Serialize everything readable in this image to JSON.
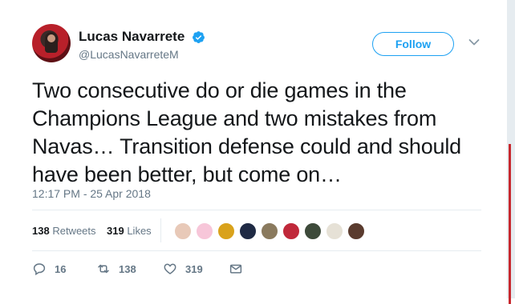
{
  "author": {
    "display_name": "Lucas Navarrete",
    "handle": "@LucasNavarreteM",
    "verified": true
  },
  "buttons": {
    "follow_label": "Follow"
  },
  "tweet": {
    "text": "Two consecutive do or die games in the Champions League and two mistakes from Navas… Transition defense could and should have been better, but come on…",
    "timestamp": "12:17 PM - 25 Apr 2018"
  },
  "stats": {
    "retweets_count": "138",
    "retweets_label": "Retweets",
    "likes_count": "319",
    "likes_label": "Likes"
  },
  "likers": [
    {
      "icon": "liker-avatar-1",
      "color": "#e8c9b8"
    },
    {
      "icon": "liker-avatar-2",
      "color": "#f7c6d9"
    },
    {
      "icon": "liker-avatar-3",
      "color": "#d9a21b"
    },
    {
      "icon": "liker-avatar-4",
      "color": "#1f2a44"
    },
    {
      "icon": "liker-avatar-5",
      "color": "#8a7a5e"
    },
    {
      "icon": "liker-avatar-6",
      "color": "#c0283a"
    },
    {
      "icon": "liker-avatar-7",
      "color": "#3d4a3a"
    },
    {
      "icon": "liker-avatar-8",
      "color": "#e6e1d6"
    },
    {
      "icon": "liker-avatar-9",
      "color": "#5a3b2e"
    }
  ],
  "actions": {
    "reply_count": "16",
    "retweet_count": "138",
    "like_count": "319"
  },
  "colors": {
    "accent": "#1da1f2",
    "muted": "#657786",
    "text": "#14171a",
    "divider": "#e6ecf0"
  }
}
